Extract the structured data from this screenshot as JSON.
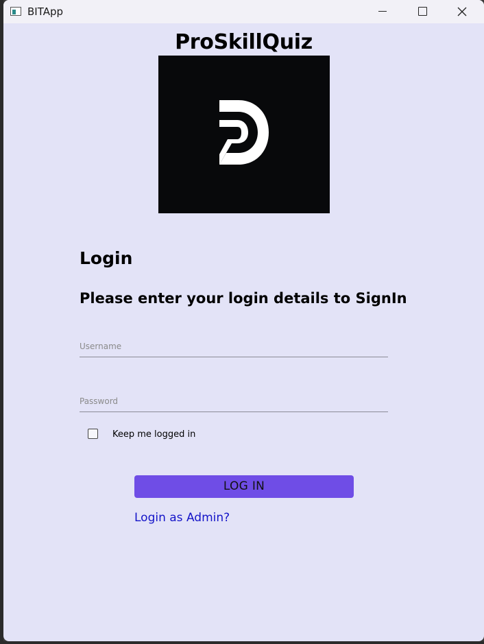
{
  "window": {
    "title": "BITApp",
    "minimize_icon": "minimize-icon",
    "maximize_icon": "maximize-icon",
    "close_icon": "close-icon"
  },
  "app": {
    "title": "ProSkillQuiz",
    "logo_icon": "dp-logo"
  },
  "login": {
    "heading": "Login",
    "subheading": "Please enter your login details to SignIn",
    "username_placeholder": "Username",
    "username_value": "",
    "password_placeholder": "Password",
    "password_value": "",
    "remember_label": "Keep me logged in",
    "remember_checked": false,
    "login_button": "LOG IN",
    "admin_link": "Login as Admin?"
  },
  "colors": {
    "background": "#e3e3f7",
    "titlebar": "#f2f1f7",
    "logo_bg": "#08090b",
    "button": "#6f4de6",
    "link": "#1414c8"
  }
}
